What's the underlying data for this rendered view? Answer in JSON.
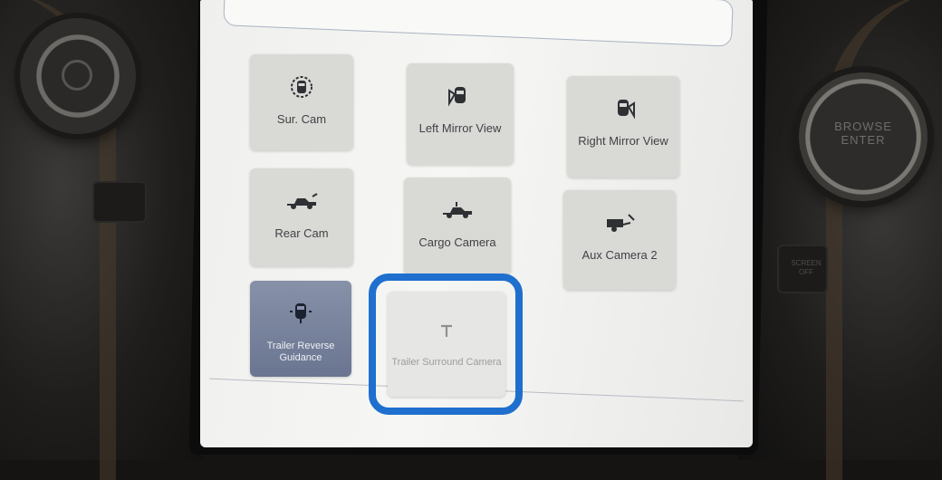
{
  "panel": {
    "right_knob_text": [
      "BROWSE",
      "ENTER"
    ],
    "right_button_text": "SCREEN OFF"
  },
  "camera_menu": {
    "items": [
      {
        "label": "Sur. Cam",
        "icon": "surround-car-icon",
        "state": "normal"
      },
      {
        "label": "Left Mirror View",
        "icon": "left-mirror-car-icon",
        "state": "normal"
      },
      {
        "label": "Right Mirror View",
        "icon": "right-mirror-car-icon",
        "state": "normal"
      },
      {
        "label": "Rear Cam",
        "icon": "rear-truck-icon",
        "state": "normal"
      },
      {
        "label": "Cargo Camera",
        "icon": "cargo-truck-icon",
        "state": "normal"
      },
      {
        "label": "Aux Camera 2",
        "icon": "trailer-icon",
        "state": "normal"
      },
      {
        "label": "Trailer Reverse Guidance",
        "icon": "trailer-reverse-icon",
        "state": "selected"
      },
      {
        "label": "Trailer Surround Camera",
        "icon": "trailer-hitch-icon",
        "state": "disabled"
      }
    ]
  },
  "annotation": {
    "highlight_color": "#1e6fce"
  }
}
